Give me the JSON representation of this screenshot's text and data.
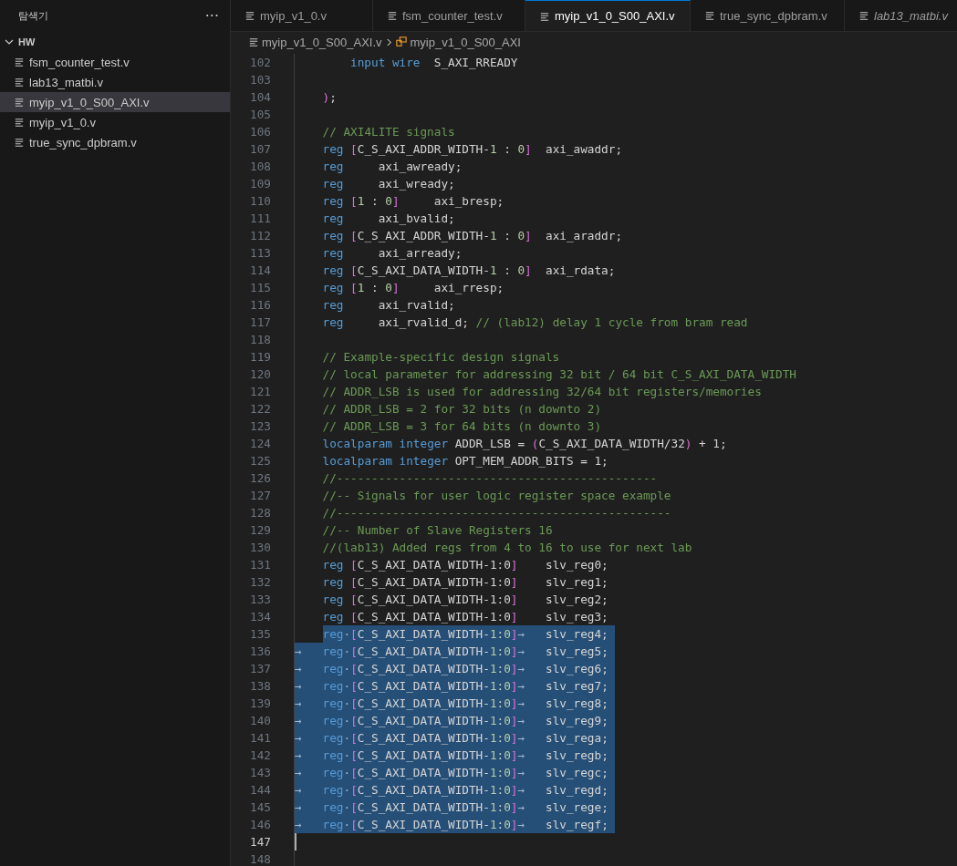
{
  "sidebar": {
    "title": "탐색기",
    "more": "···",
    "folder": {
      "name": "HW",
      "expanded": true,
      "files": [
        {
          "name": "fsm_counter_test.v",
          "selected": false
        },
        {
          "name": "lab13_matbi.v",
          "selected": false
        },
        {
          "name": "myip_v1_0_S00_AXI.v",
          "selected": true
        },
        {
          "name": "myip_v1_0.v",
          "selected": false
        },
        {
          "name": "true_sync_dpbram.v",
          "selected": false
        }
      ]
    }
  },
  "tabs": [
    {
      "label": "myip_v1_0.v",
      "selected": false,
      "preview": false
    },
    {
      "label": "fsm_counter_test.v",
      "selected": false,
      "preview": false
    },
    {
      "label": "myip_v1_0_S00_AXI.v",
      "selected": true,
      "preview": false
    },
    {
      "label": "true_sync_dpbram.v",
      "selected": false,
      "preview": false
    },
    {
      "label": "lab13_matbi.v",
      "selected": false,
      "preview": true
    }
  ],
  "breadcrumb": {
    "file": "myip_v1_0_S00_AXI.v",
    "symbol": "myip_v1_0_S00_AXI"
  },
  "editor": {
    "lines": [
      {
        "number": "102",
        "selected": false,
        "current": false,
        "kind": "nested",
        "tokens": [
          {
            "kind": "kw",
            "text": "input "
          },
          {
            "kind": "kw",
            "text": "wire"
          },
          {
            "kind": "id",
            "text": "  S_AXI_RREADY"
          }
        ]
      },
      {
        "number": "103",
        "selected": false,
        "current": false,
        "kind": "blank"
      },
      {
        "number": "104",
        "selected": false,
        "current": false,
        "kind": "code",
        "tokens": [
          {
            "kind": "br",
            "text": ")"
          },
          {
            "kind": "id",
            "text": ";"
          }
        ]
      },
      {
        "number": "105",
        "selected": false,
        "current": false,
        "kind": "blank"
      },
      {
        "number": "106",
        "selected": false,
        "current": false,
        "kind": "code",
        "tokens": [
          {
            "kind": "cm",
            "text": "// AXI4LITE signals"
          }
        ]
      },
      {
        "number": "107",
        "selected": false,
        "current": false,
        "kind": "code",
        "tokens": [
          {
            "kind": "kw",
            "text": "reg "
          },
          {
            "kind": "br",
            "text": "["
          },
          {
            "kind": "id",
            "text": "C_S_AXI_ADDR_WIDTH-"
          },
          {
            "kind": "num",
            "text": "1"
          },
          {
            "kind": "id",
            "text": " : "
          },
          {
            "kind": "num",
            "text": "0"
          },
          {
            "kind": "br",
            "text": "]"
          },
          {
            "kind": "id",
            "text": "  axi_awaddr;"
          }
        ]
      },
      {
        "number": "108",
        "selected": false,
        "current": false,
        "kind": "code",
        "tokens": [
          {
            "kind": "kw",
            "text": "reg"
          },
          {
            "kind": "id",
            "text": "     axi_awready;"
          }
        ]
      },
      {
        "number": "109",
        "selected": false,
        "current": false,
        "kind": "code",
        "tokens": [
          {
            "kind": "kw",
            "text": "reg"
          },
          {
            "kind": "id",
            "text": "     axi_wready;"
          }
        ]
      },
      {
        "number": "110",
        "selected": false,
        "current": false,
        "kind": "code",
        "tokens": [
          {
            "kind": "kw",
            "text": "reg "
          },
          {
            "kind": "br",
            "text": "["
          },
          {
            "kind": "num",
            "text": "1"
          },
          {
            "kind": "id",
            "text": " : "
          },
          {
            "kind": "num",
            "text": "0"
          },
          {
            "kind": "br",
            "text": "]"
          },
          {
            "kind": "id",
            "text": "     axi_bresp;"
          }
        ]
      },
      {
        "number": "111",
        "selected": false,
        "current": false,
        "kind": "code",
        "tokens": [
          {
            "kind": "kw",
            "text": "reg"
          },
          {
            "kind": "id",
            "text": "     axi_bvalid;"
          }
        ]
      },
      {
        "number": "112",
        "selected": false,
        "current": false,
        "kind": "code",
        "tokens": [
          {
            "kind": "kw",
            "text": "reg "
          },
          {
            "kind": "br",
            "text": "["
          },
          {
            "kind": "id",
            "text": "C_S_AXI_ADDR_WIDTH-"
          },
          {
            "kind": "num",
            "text": "1"
          },
          {
            "kind": "id",
            "text": " : "
          },
          {
            "kind": "num",
            "text": "0"
          },
          {
            "kind": "br",
            "text": "]"
          },
          {
            "kind": "id",
            "text": "  axi_araddr;"
          }
        ]
      },
      {
        "number": "113",
        "selected": false,
        "current": false,
        "kind": "code",
        "tokens": [
          {
            "kind": "kw",
            "text": "reg"
          },
          {
            "kind": "id",
            "text": "     axi_arready;"
          }
        ]
      },
      {
        "number": "114",
        "selected": false,
        "current": false,
        "kind": "code",
        "tokens": [
          {
            "kind": "kw",
            "text": "reg "
          },
          {
            "kind": "br",
            "text": "["
          },
          {
            "kind": "id",
            "text": "C_S_AXI_DATA_WIDTH-"
          },
          {
            "kind": "num",
            "text": "1"
          },
          {
            "kind": "id",
            "text": " : "
          },
          {
            "kind": "num",
            "text": "0"
          },
          {
            "kind": "br",
            "text": "]"
          },
          {
            "kind": "id",
            "text": "  axi_rdata;"
          }
        ]
      },
      {
        "number": "115",
        "selected": false,
        "current": false,
        "kind": "code",
        "tokens": [
          {
            "kind": "kw",
            "text": "reg "
          },
          {
            "kind": "br",
            "text": "["
          },
          {
            "kind": "num",
            "text": "1"
          },
          {
            "kind": "id",
            "text": " : "
          },
          {
            "kind": "num",
            "text": "0"
          },
          {
            "kind": "br",
            "text": "]"
          },
          {
            "kind": "id",
            "text": "     axi_rresp;"
          }
        ]
      },
      {
        "number": "116",
        "selected": false,
        "current": false,
        "kind": "code",
        "tokens": [
          {
            "kind": "kw",
            "text": "reg"
          },
          {
            "kind": "id",
            "text": "     axi_rvalid;"
          }
        ]
      },
      {
        "number": "117",
        "selected": false,
        "current": false,
        "kind": "code",
        "tokens": [
          {
            "kind": "kw",
            "text": "reg"
          },
          {
            "kind": "id",
            "text": "     axi_rvalid_d; "
          },
          {
            "kind": "cm",
            "text": "// (lab12) delay 1 cycle from bram read"
          }
        ]
      },
      {
        "number": "118",
        "selected": false,
        "current": false,
        "kind": "blank"
      },
      {
        "number": "119",
        "selected": false,
        "current": false,
        "kind": "code",
        "tokens": [
          {
            "kind": "cm",
            "text": "// Example-specific design signals"
          }
        ]
      },
      {
        "number": "120",
        "selected": false,
        "current": false,
        "kind": "code",
        "tokens": [
          {
            "kind": "cm",
            "text": "// local parameter for addressing 32 bit / 64 bit C_S_AXI_DATA_WIDTH"
          }
        ]
      },
      {
        "number": "121",
        "selected": false,
        "current": false,
        "kind": "code",
        "tokens": [
          {
            "kind": "cm",
            "text": "// ADDR_LSB is used for addressing 32/64 bit registers/memories"
          }
        ]
      },
      {
        "number": "122",
        "selected": false,
        "current": false,
        "kind": "code",
        "tokens": [
          {
            "kind": "cm",
            "text": "// ADDR_LSB = 2 for 32 bits (n downto 2)"
          }
        ]
      },
      {
        "number": "123",
        "selected": false,
        "current": false,
        "kind": "code",
        "tokens": [
          {
            "kind": "cm",
            "text": "// ADDR_LSB = 3 for 64 bits (n downto 3)"
          }
        ]
      },
      {
        "number": "124",
        "selected": false,
        "current": false,
        "kind": "code",
        "tokens": [
          {
            "kind": "kw",
            "text": "localparam "
          },
          {
            "kind": "kw",
            "text": "integer"
          },
          {
            "kind": "id",
            "text": " ADDR_LSB = "
          },
          {
            "kind": "br",
            "text": "("
          },
          {
            "kind": "id",
            "text": "C_S_AXI_DATA_WIDTH/32"
          },
          {
            "kind": "br",
            "text": ")"
          },
          {
            "kind": "id",
            "text": " + 1;"
          }
        ]
      },
      {
        "number": "125",
        "selected": false,
        "current": false,
        "kind": "code",
        "tokens": [
          {
            "kind": "kw",
            "text": "localparam "
          },
          {
            "kind": "kw",
            "text": "integer"
          },
          {
            "kind": "id",
            "text": " OPT_MEM_ADDR_BITS = 1;"
          }
        ]
      },
      {
        "number": "126",
        "selected": false,
        "current": false,
        "kind": "code",
        "tokens": [
          {
            "kind": "cm",
            "text": "//----------------------------------------------"
          }
        ]
      },
      {
        "number": "127",
        "selected": false,
        "current": false,
        "kind": "code",
        "tokens": [
          {
            "kind": "cm",
            "text": "//-- Signals for user logic register space example"
          }
        ]
      },
      {
        "number": "128",
        "selected": false,
        "current": false,
        "kind": "code",
        "tokens": [
          {
            "kind": "cm",
            "text": "//------------------------------------------------"
          }
        ]
      },
      {
        "number": "129",
        "selected": false,
        "current": false,
        "kind": "code",
        "tokens": [
          {
            "kind": "cm",
            "text": "//-- Number of Slave Registers 16"
          }
        ]
      },
      {
        "number": "130",
        "selected": false,
        "current": false,
        "kind": "code",
        "tokens": [
          {
            "kind": "cm",
            "text": "//(lab13) Added regs from 4 to 16 to use for next lab"
          }
        ]
      },
      {
        "number": "131",
        "selected": false,
        "current": false,
        "kind": "code",
        "tokens": [
          {
            "kind": "kw",
            "text": "reg "
          },
          {
            "kind": "br",
            "text": "["
          },
          {
            "kind": "id",
            "text": "C_S_AXI_DATA_WIDTH-1:0"
          },
          {
            "kind": "br",
            "text": "]"
          },
          {
            "kind": "id",
            "text": "    slv_reg0;"
          }
        ]
      },
      {
        "number": "132",
        "selected": false,
        "current": false,
        "kind": "code",
        "tokens": [
          {
            "kind": "kw",
            "text": "reg "
          },
          {
            "kind": "br",
            "text": "["
          },
          {
            "kind": "id",
            "text": "C_S_AXI_DATA_WIDTH-1:0"
          },
          {
            "kind": "br",
            "text": "]"
          },
          {
            "kind": "id",
            "text": "    slv_reg1;"
          }
        ]
      },
      {
        "number": "133",
        "selected": false,
        "current": false,
        "kind": "code",
        "tokens": [
          {
            "kind": "kw",
            "text": "reg "
          },
          {
            "kind": "br",
            "text": "["
          },
          {
            "kind": "id",
            "text": "C_S_AXI_DATA_WIDTH-1:0"
          },
          {
            "kind": "br",
            "text": "]"
          },
          {
            "kind": "id",
            "text": "    slv_reg2;"
          }
        ]
      },
      {
        "number": "134",
        "selected": false,
        "current": false,
        "kind": "code",
        "tokens": [
          {
            "kind": "kw",
            "text": "reg "
          },
          {
            "kind": "br",
            "text": "["
          },
          {
            "kind": "id",
            "text": "C_S_AXI_DATA_WIDTH-1:0"
          },
          {
            "kind": "br",
            "text": "]"
          },
          {
            "kind": "id",
            "text": "    slv_reg3;"
          }
        ]
      },
      {
        "number": "135",
        "selected": true,
        "current": false,
        "kind": "code",
        "tokens": [
          {
            "kind": "kw",
            "text": "reg"
          },
          {
            "kind": "ws",
            "text": "·"
          },
          {
            "kind": "br",
            "text": "["
          },
          {
            "kind": "id",
            "text": "C_S_AXI_DATA_WIDTH-"
          },
          {
            "kind": "num",
            "text": "1"
          },
          {
            "kind": "id",
            "text": ":"
          },
          {
            "kind": "num",
            "text": "0"
          },
          {
            "kind": "br",
            "text": "]"
          },
          {
            "kind": "ws",
            "text": "→"
          },
          {
            "kind": "id",
            "text": "   slv_reg4;"
          }
        ]
      },
      {
        "number": "136",
        "selected": true,
        "current": false,
        "kind": "tabbed",
        "tokens": [
          {
            "kind": "ws",
            "text": "→   "
          },
          {
            "kind": "kw",
            "text": "reg"
          },
          {
            "kind": "ws",
            "text": "·"
          },
          {
            "kind": "br",
            "text": "["
          },
          {
            "kind": "id",
            "text": "C_S_AXI_DATA_WIDTH-"
          },
          {
            "kind": "num",
            "text": "1"
          },
          {
            "kind": "id",
            "text": ":"
          },
          {
            "kind": "num",
            "text": "0"
          },
          {
            "kind": "br",
            "text": "]"
          },
          {
            "kind": "ws",
            "text": "→"
          },
          {
            "kind": "id",
            "text": "   slv_reg5;"
          }
        ]
      },
      {
        "number": "137",
        "selected": true,
        "current": false,
        "kind": "tabbed",
        "tokens": [
          {
            "kind": "ws",
            "text": "→   "
          },
          {
            "kind": "kw",
            "text": "reg"
          },
          {
            "kind": "ws",
            "text": "·"
          },
          {
            "kind": "br",
            "text": "["
          },
          {
            "kind": "id",
            "text": "C_S_AXI_DATA_WIDTH-"
          },
          {
            "kind": "num",
            "text": "1"
          },
          {
            "kind": "id",
            "text": ":"
          },
          {
            "kind": "num",
            "text": "0"
          },
          {
            "kind": "br",
            "text": "]"
          },
          {
            "kind": "ws",
            "text": "→"
          },
          {
            "kind": "id",
            "text": "   slv_reg6;"
          }
        ]
      },
      {
        "number": "138",
        "selected": true,
        "current": false,
        "kind": "tabbed",
        "tokens": [
          {
            "kind": "ws",
            "text": "→   "
          },
          {
            "kind": "kw",
            "text": "reg"
          },
          {
            "kind": "ws",
            "text": "·"
          },
          {
            "kind": "br",
            "text": "["
          },
          {
            "kind": "id",
            "text": "C_S_AXI_DATA_WIDTH-"
          },
          {
            "kind": "num",
            "text": "1"
          },
          {
            "kind": "id",
            "text": ":"
          },
          {
            "kind": "num",
            "text": "0"
          },
          {
            "kind": "br",
            "text": "]"
          },
          {
            "kind": "ws",
            "text": "→"
          },
          {
            "kind": "id",
            "text": "   slv_reg7;"
          }
        ]
      },
      {
        "number": "139",
        "selected": true,
        "current": false,
        "kind": "tabbed",
        "tokens": [
          {
            "kind": "ws",
            "text": "→   "
          },
          {
            "kind": "kw",
            "text": "reg"
          },
          {
            "kind": "ws",
            "text": "·"
          },
          {
            "kind": "br",
            "text": "["
          },
          {
            "kind": "id",
            "text": "C_S_AXI_DATA_WIDTH-"
          },
          {
            "kind": "num",
            "text": "1"
          },
          {
            "kind": "id",
            "text": ":"
          },
          {
            "kind": "num",
            "text": "0"
          },
          {
            "kind": "br",
            "text": "]"
          },
          {
            "kind": "ws",
            "text": "→"
          },
          {
            "kind": "id",
            "text": "   slv_reg8;"
          }
        ]
      },
      {
        "number": "140",
        "selected": true,
        "current": false,
        "kind": "tabbed",
        "tokens": [
          {
            "kind": "ws",
            "text": "→   "
          },
          {
            "kind": "kw",
            "text": "reg"
          },
          {
            "kind": "ws",
            "text": "·"
          },
          {
            "kind": "br",
            "text": "["
          },
          {
            "kind": "id",
            "text": "C_S_AXI_DATA_WIDTH-"
          },
          {
            "kind": "num",
            "text": "1"
          },
          {
            "kind": "id",
            "text": ":"
          },
          {
            "kind": "num",
            "text": "0"
          },
          {
            "kind": "br",
            "text": "]"
          },
          {
            "kind": "ws",
            "text": "→"
          },
          {
            "kind": "id",
            "text": "   slv_reg9;"
          }
        ]
      },
      {
        "number": "141",
        "selected": true,
        "current": false,
        "kind": "tabbed",
        "tokens": [
          {
            "kind": "ws",
            "text": "→   "
          },
          {
            "kind": "kw",
            "text": "reg"
          },
          {
            "kind": "ws",
            "text": "·"
          },
          {
            "kind": "br",
            "text": "["
          },
          {
            "kind": "id",
            "text": "C_S_AXI_DATA_WIDTH-"
          },
          {
            "kind": "num",
            "text": "1"
          },
          {
            "kind": "id",
            "text": ":"
          },
          {
            "kind": "num",
            "text": "0"
          },
          {
            "kind": "br",
            "text": "]"
          },
          {
            "kind": "ws",
            "text": "→"
          },
          {
            "kind": "id",
            "text": "   slv_rega;"
          }
        ]
      },
      {
        "number": "142",
        "selected": true,
        "current": false,
        "kind": "tabbed",
        "tokens": [
          {
            "kind": "ws",
            "text": "→   "
          },
          {
            "kind": "kw",
            "text": "reg"
          },
          {
            "kind": "ws",
            "text": "·"
          },
          {
            "kind": "br",
            "text": "["
          },
          {
            "kind": "id",
            "text": "C_S_AXI_DATA_WIDTH-"
          },
          {
            "kind": "num",
            "text": "1"
          },
          {
            "kind": "id",
            "text": ":"
          },
          {
            "kind": "num",
            "text": "0"
          },
          {
            "kind": "br",
            "text": "]"
          },
          {
            "kind": "ws",
            "text": "→"
          },
          {
            "kind": "id",
            "text": "   slv_regb;"
          }
        ]
      },
      {
        "number": "143",
        "selected": true,
        "current": false,
        "kind": "tabbed",
        "tokens": [
          {
            "kind": "ws",
            "text": "→   "
          },
          {
            "kind": "kw",
            "text": "reg"
          },
          {
            "kind": "ws",
            "text": "·"
          },
          {
            "kind": "br",
            "text": "["
          },
          {
            "kind": "id",
            "text": "C_S_AXI_DATA_WIDTH-"
          },
          {
            "kind": "num",
            "text": "1"
          },
          {
            "kind": "id",
            "text": ":"
          },
          {
            "kind": "num",
            "text": "0"
          },
          {
            "kind": "br",
            "text": "]"
          },
          {
            "kind": "ws",
            "text": "→"
          },
          {
            "kind": "id",
            "text": "   slv_regc;"
          }
        ]
      },
      {
        "number": "144",
        "selected": true,
        "current": false,
        "kind": "tabbed",
        "tokens": [
          {
            "kind": "ws",
            "text": "→   "
          },
          {
            "kind": "kw",
            "text": "reg"
          },
          {
            "kind": "ws",
            "text": "·"
          },
          {
            "kind": "br",
            "text": "["
          },
          {
            "kind": "id",
            "text": "C_S_AXI_DATA_WIDTH-"
          },
          {
            "kind": "num",
            "text": "1"
          },
          {
            "kind": "id",
            "text": ":"
          },
          {
            "kind": "num",
            "text": "0"
          },
          {
            "kind": "br",
            "text": "]"
          },
          {
            "kind": "ws",
            "text": "→"
          },
          {
            "kind": "id",
            "text": "   slv_regd;"
          }
        ]
      },
      {
        "number": "145",
        "selected": true,
        "current": false,
        "kind": "tabbed",
        "tokens": [
          {
            "kind": "ws",
            "text": "→   "
          },
          {
            "kind": "kw",
            "text": "reg"
          },
          {
            "kind": "ws",
            "text": "·"
          },
          {
            "kind": "br",
            "text": "["
          },
          {
            "kind": "id",
            "text": "C_S_AXI_DATA_WIDTH-"
          },
          {
            "kind": "num",
            "text": "1"
          },
          {
            "kind": "id",
            "text": ":"
          },
          {
            "kind": "num",
            "text": "0"
          },
          {
            "kind": "br",
            "text": "]"
          },
          {
            "kind": "ws",
            "text": "→"
          },
          {
            "kind": "id",
            "text": "   slv_rege;"
          }
        ]
      },
      {
        "number": "146",
        "selected": true,
        "current": false,
        "kind": "tabbed",
        "tokens": [
          {
            "kind": "ws",
            "text": "→   "
          },
          {
            "kind": "kw",
            "text": "reg"
          },
          {
            "kind": "ws",
            "text": "·"
          },
          {
            "kind": "br",
            "text": "["
          },
          {
            "kind": "id",
            "text": "C_S_AXI_DATA_WIDTH-"
          },
          {
            "kind": "num",
            "text": "1"
          },
          {
            "kind": "id",
            "text": ":"
          },
          {
            "kind": "num",
            "text": "0"
          },
          {
            "kind": "br",
            "text": "]"
          },
          {
            "kind": "ws",
            "text": "→"
          },
          {
            "kind": "id",
            "text": "   slv_regf;"
          }
        ]
      },
      {
        "number": "147",
        "selected": false,
        "current": true,
        "kind": "blank"
      },
      {
        "number": "148",
        "selected": false,
        "current": false,
        "kind": "blank"
      }
    ]
  }
}
